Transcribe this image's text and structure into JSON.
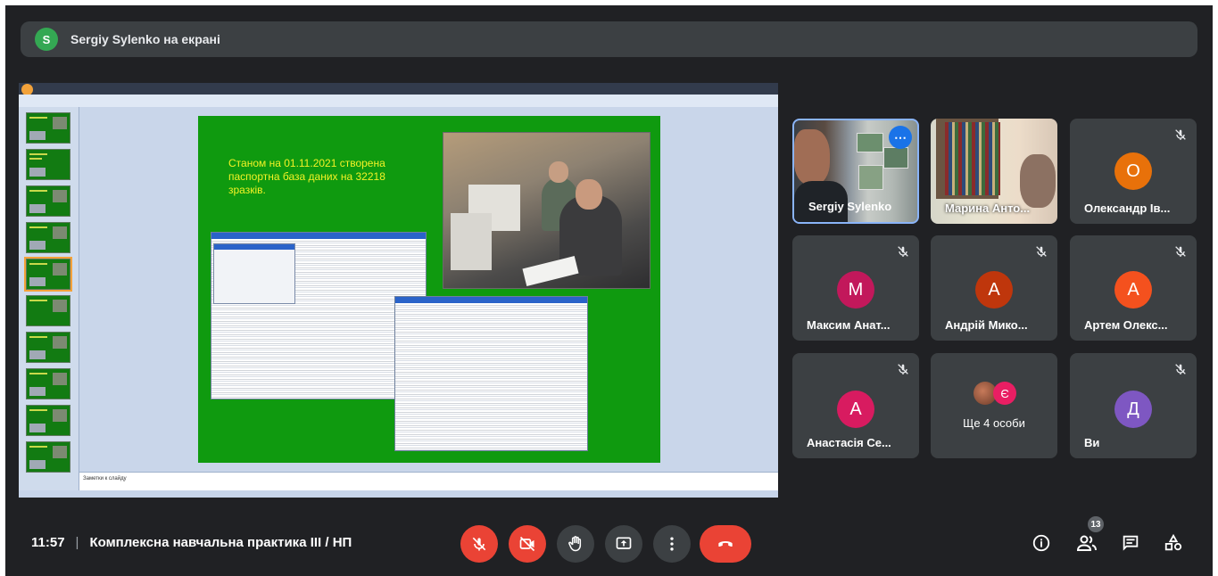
{
  "banner": {
    "avatar_letter": "S",
    "text": "Sergiy Sylenko на екрані"
  },
  "presentation": {
    "slide_text": "Станом на 01.11.2021 створена паспортна база даних на 32218 зразків.",
    "notes_placeholder": "Заметки к слайду"
  },
  "participants": [
    {
      "name": "Sergiy Sylenko",
      "type": "video",
      "muted": false
    },
    {
      "name": "Марина Анто...",
      "type": "video",
      "muted": false
    },
    {
      "name": "Олександр Ів...",
      "initial": "О",
      "color": "#e8710a",
      "muted": true
    },
    {
      "name": "Максим Анат...",
      "initial": "М",
      "color": "#c2185b",
      "muted": true
    },
    {
      "name": "Андрій Мико...",
      "initial": "А",
      "color": "#bf360c",
      "muted": true
    },
    {
      "name": "Артем Олекс...",
      "initial": "А",
      "color": "#f4511e",
      "muted": true
    },
    {
      "name": "Анастасія Се...",
      "initial": "А",
      "color": "#d81b60",
      "muted": true
    },
    {
      "name": "Ще 4 особи",
      "initial": "Є",
      "color": "#e91e63",
      "muted": false
    },
    {
      "name": "Ви",
      "initial": "Д",
      "color": "#7e57c2",
      "muted": true
    }
  ],
  "meeting": {
    "time": "11:57",
    "separator": "|",
    "title": "Комплексна навчальна практика III / НП",
    "participant_count": "13"
  }
}
